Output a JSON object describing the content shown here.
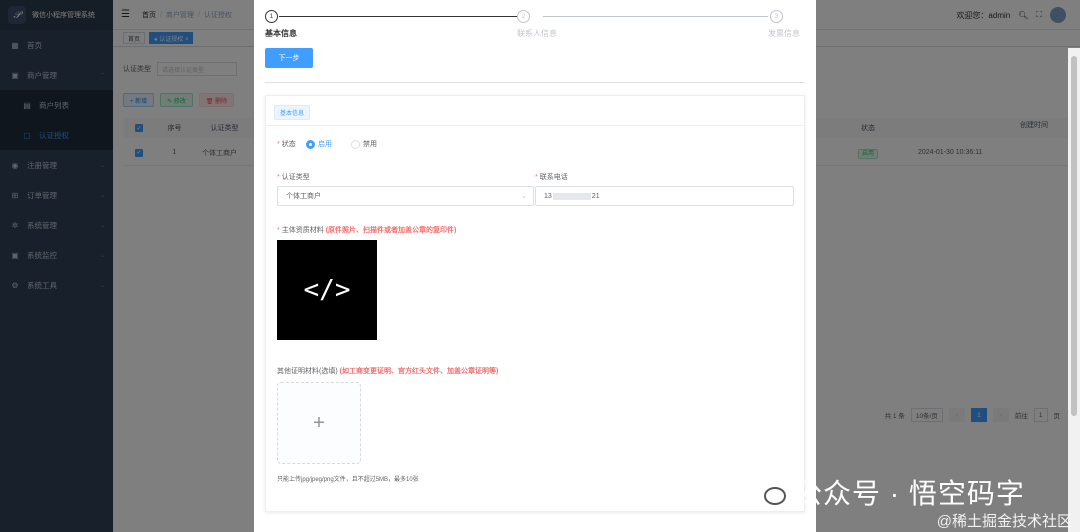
{
  "app": {
    "title": "微信小程序管理系统",
    "logo_glyph": "𝒫"
  },
  "sidebar": {
    "items": [
      {
        "icon": "dashboard-icon",
        "glyph": "▦",
        "label": "首页",
        "arrow": ""
      },
      {
        "icon": "shop-icon",
        "glyph": "▣",
        "label": "商户管理",
        "arrow": "⌃"
      },
      {
        "icon": "list-icon",
        "glyph": "▤",
        "label": "商户列表",
        "arrow": "",
        "sub": true
      },
      {
        "icon": "doc-icon",
        "glyph": "▢",
        "label": "认证授权",
        "arrow": "",
        "sub": true,
        "active": true
      },
      {
        "icon": "register-icon",
        "glyph": "◉",
        "label": "注册管理",
        "arrow": "⌄"
      },
      {
        "icon": "cart-icon",
        "glyph": "⊞",
        "label": "订单管理",
        "arrow": "⌄"
      },
      {
        "icon": "gear-icon",
        "glyph": "✲",
        "label": "系统管理",
        "arrow": "⌄"
      },
      {
        "icon": "monitor-icon",
        "glyph": "▣",
        "label": "系统监控",
        "arrow": "⌄"
      },
      {
        "icon": "tool-icon",
        "glyph": "⚙",
        "label": "系统工具",
        "arrow": "⌄"
      }
    ]
  },
  "topbar": {
    "crumbs": [
      "首页",
      "商户管理",
      "认证授权"
    ],
    "welcome": "欢迎您：admin",
    "icons": [
      "search-icon",
      "fullscreen-icon",
      "avatar"
    ]
  },
  "tags": [
    {
      "label": "首页",
      "active": false
    },
    {
      "label": "● 认证授权 ×",
      "active": true
    }
  ],
  "bg": {
    "filter_label": "认证类型",
    "filter_placeholder": "请选择认证类型",
    "buttons": {
      "add": "+ 新增",
      "edit": "✎ 修改",
      "del": "🗑 删除"
    },
    "columns": [
      "序号",
      "认证类型",
      "状态",
      "创建时间"
    ],
    "row": {
      "index": "1",
      "type": "个体工商户",
      "status": "启用",
      "created": "2024-01-30 10:36:11"
    },
    "pager": {
      "total": "共 1 条",
      "size": "10条/页",
      "page": "1",
      "goto": "前往",
      "goto_page": "1",
      "goto_suffix": "页"
    }
  },
  "drawer": {
    "steps": [
      {
        "num": "1",
        "title": "基本信息",
        "done": true
      },
      {
        "num": "2",
        "title": "联系人信息",
        "done": false
      },
      {
        "num": "3",
        "title": "发票信息",
        "done": false
      }
    ],
    "next_label": "下一步",
    "card_tag": "基本信息",
    "status_label": "状态",
    "status_on": "启用",
    "status_off": "禁用",
    "type_label": "认证类型",
    "type_value": "个体工商户",
    "phone_label": "联系电话",
    "phone_prefix": "13",
    "phone_suffix": "21",
    "main_material_label": "主体资质材料",
    "main_material_hint": "(原件照片、扫描件或者加盖公章的复印件)",
    "code_glyph": "</>",
    "other_material_label": "其他证明材料(选填)",
    "other_material_hint": "(如工商变更证明、官方红头文件、加盖公章证明等)",
    "upload_plus": "+",
    "upload_tip": "只能上传jpg/jpeg/png文件，且不超过5MB，最多10张"
  },
  "watermark": {
    "text": "公众号 · 悟空码字",
    "sub": "@稀土掘金技术社区"
  }
}
